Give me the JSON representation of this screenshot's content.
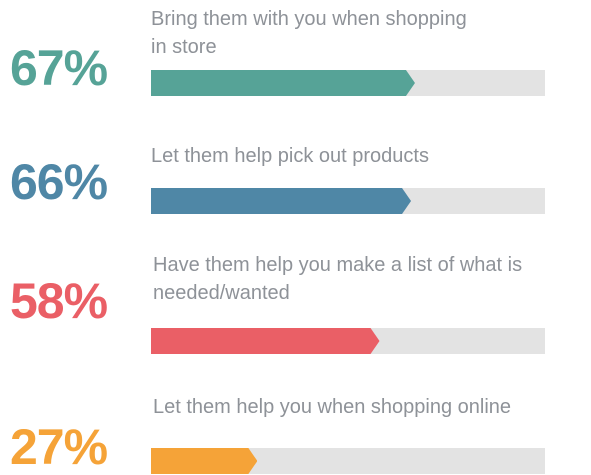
{
  "chart_data": {
    "type": "bar",
    "orientation": "horizontal",
    "ylim": [
      0,
      100
    ],
    "rows": [
      {
        "percent_label": "67%",
        "value": 67,
        "label_line1": "Bring them with you when shopping",
        "label_line2": "in store",
        "color": "#56a397"
      },
      {
        "percent_label": "66%",
        "value": 66,
        "label_line1": "Let them help pick out products",
        "label_line2": "",
        "color": "#4f87a6"
      },
      {
        "percent_label": "58%",
        "value": 58,
        "label_line1": "Have them help you make a list of what is",
        "label_line2": "needed/wanted",
        "color": "#ea5f66"
      },
      {
        "percent_label": "27%",
        "value": 27,
        "label_line1": "Let them help you when shopping online",
        "label_line2": "",
        "color": "#f5a338"
      }
    ]
  }
}
